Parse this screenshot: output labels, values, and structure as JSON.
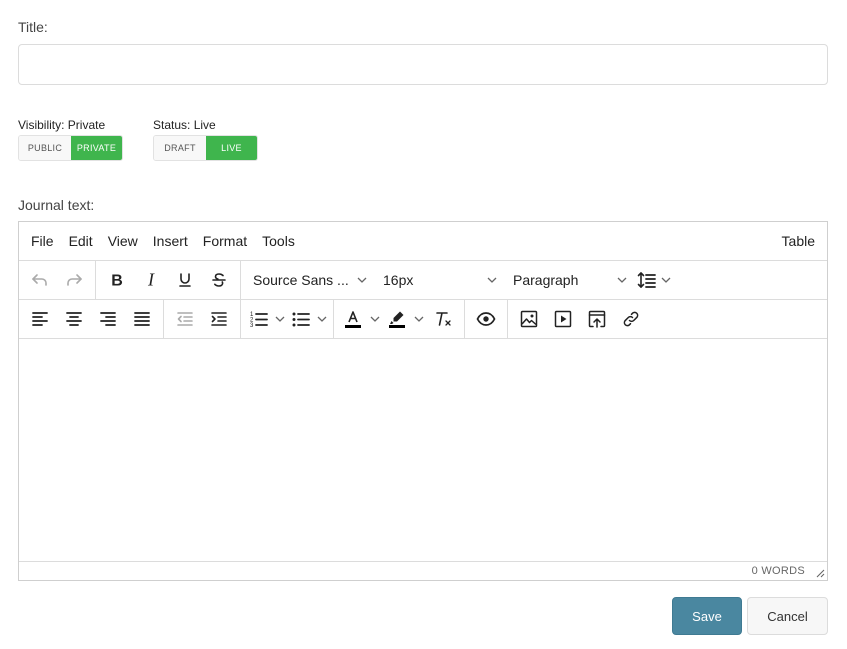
{
  "form": {
    "title_label": "Title:",
    "title_value": "",
    "visibility": {
      "caption": "Visibility: Private",
      "options": [
        "PUBLIC",
        "PRIVATE"
      ],
      "selected": "PRIVATE"
    },
    "status": {
      "caption": "Status: Live",
      "options": [
        "DRAFT",
        "LIVE"
      ],
      "selected": "LIVE"
    },
    "journal_label": "Journal text:"
  },
  "editor": {
    "menu": [
      "File",
      "Edit",
      "View",
      "Insert",
      "Format",
      "Tools"
    ],
    "menu_right": "Table",
    "font_family": "Source Sans ...",
    "font_size": "16px",
    "block_format": "Paragraph",
    "word_count": "0 WORDS"
  },
  "buttons": {
    "save": "Save",
    "cancel": "Cancel"
  },
  "colors": {
    "toggle_active": "#3fb54d",
    "save": "#4a87a0"
  }
}
